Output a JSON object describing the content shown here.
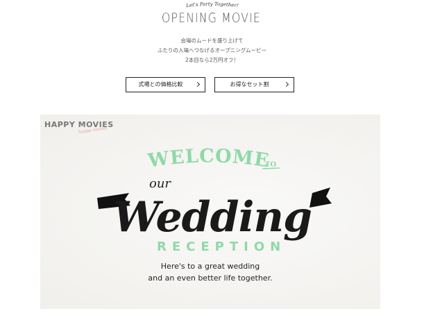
{
  "header": {
    "tagline": "Let's Party Together!",
    "title": "OPENING MOVIE",
    "description": [
      "会場のムードを盛り上げて",
      "ふたりの入場へつなげるオープニングムービー",
      "2本目なら2万円オフ！"
    ]
  },
  "buttons": {
    "compare_label": "式場との価格比較",
    "set_label": "お得なセット割"
  },
  "video": {
    "brand": "HAPPY MOVIES",
    "brand_script": "happy movies",
    "welcome": "WELCOME",
    "to": "TO",
    "our": "our",
    "wedding": "Wedding",
    "reception": "RECEPTION",
    "message_line1": "Here's to a great wedding",
    "message_line2": "and an even better life together."
  },
  "colors": {
    "accent_green": "#8fd9a8",
    "ink": "#1a1a1a",
    "brand_pink": "#e6a0a4"
  },
  "icons": {
    "button_chevron": "chevron-right-icon"
  }
}
